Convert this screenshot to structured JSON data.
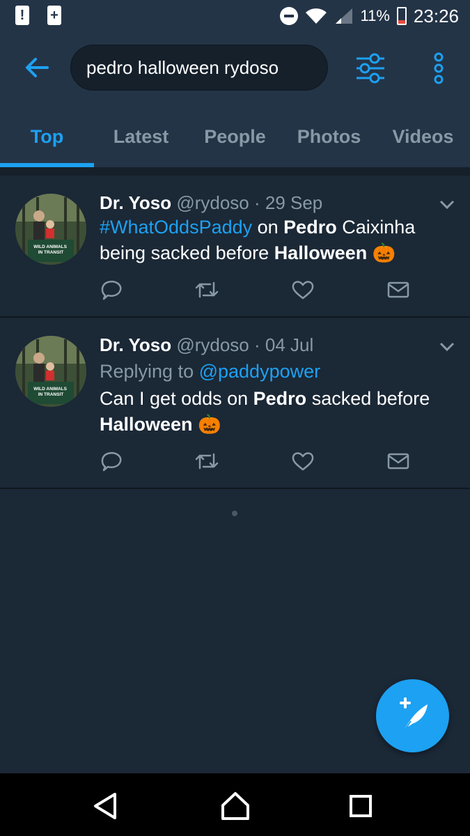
{
  "status_bar": {
    "time": "23:26",
    "battery": "11%"
  },
  "search": {
    "query": "pedro halloween rydoso"
  },
  "tabs": [
    {
      "label": "Top",
      "active": true
    },
    {
      "label": "Latest",
      "active": false
    },
    {
      "label": "People",
      "active": false
    },
    {
      "label": "Photos",
      "active": false
    },
    {
      "label": "Videos",
      "active": false
    }
  ],
  "tweets": [
    {
      "name": "Dr. Yoso",
      "handle": "@rydoso",
      "date": "· 29 Sep",
      "hashtag": "#WhatOddsPaddy",
      "t1": " on ",
      "b1": "Pedro",
      "t2": " Caixinha being sacked before ",
      "b2": "Halloween",
      "emoji": "🎃"
    },
    {
      "name": "Dr. Yoso",
      "handle": "@rydoso",
      "date": "· 04 Jul",
      "reply_prefix": "Replying to ",
      "reply_to": "@paddypower",
      "t1": "Can I get odds on ",
      "b1": "Pedro",
      "t2": " sacked before ",
      "b2": "Halloween",
      "emoji": "🎃"
    }
  ],
  "avatar_sign": "WILD ANIMALS IN TRANSIT",
  "colors": {
    "accent": "#1da1f2",
    "background": "#1b2836",
    "header": "#243447",
    "muted": "#8899a6"
  }
}
